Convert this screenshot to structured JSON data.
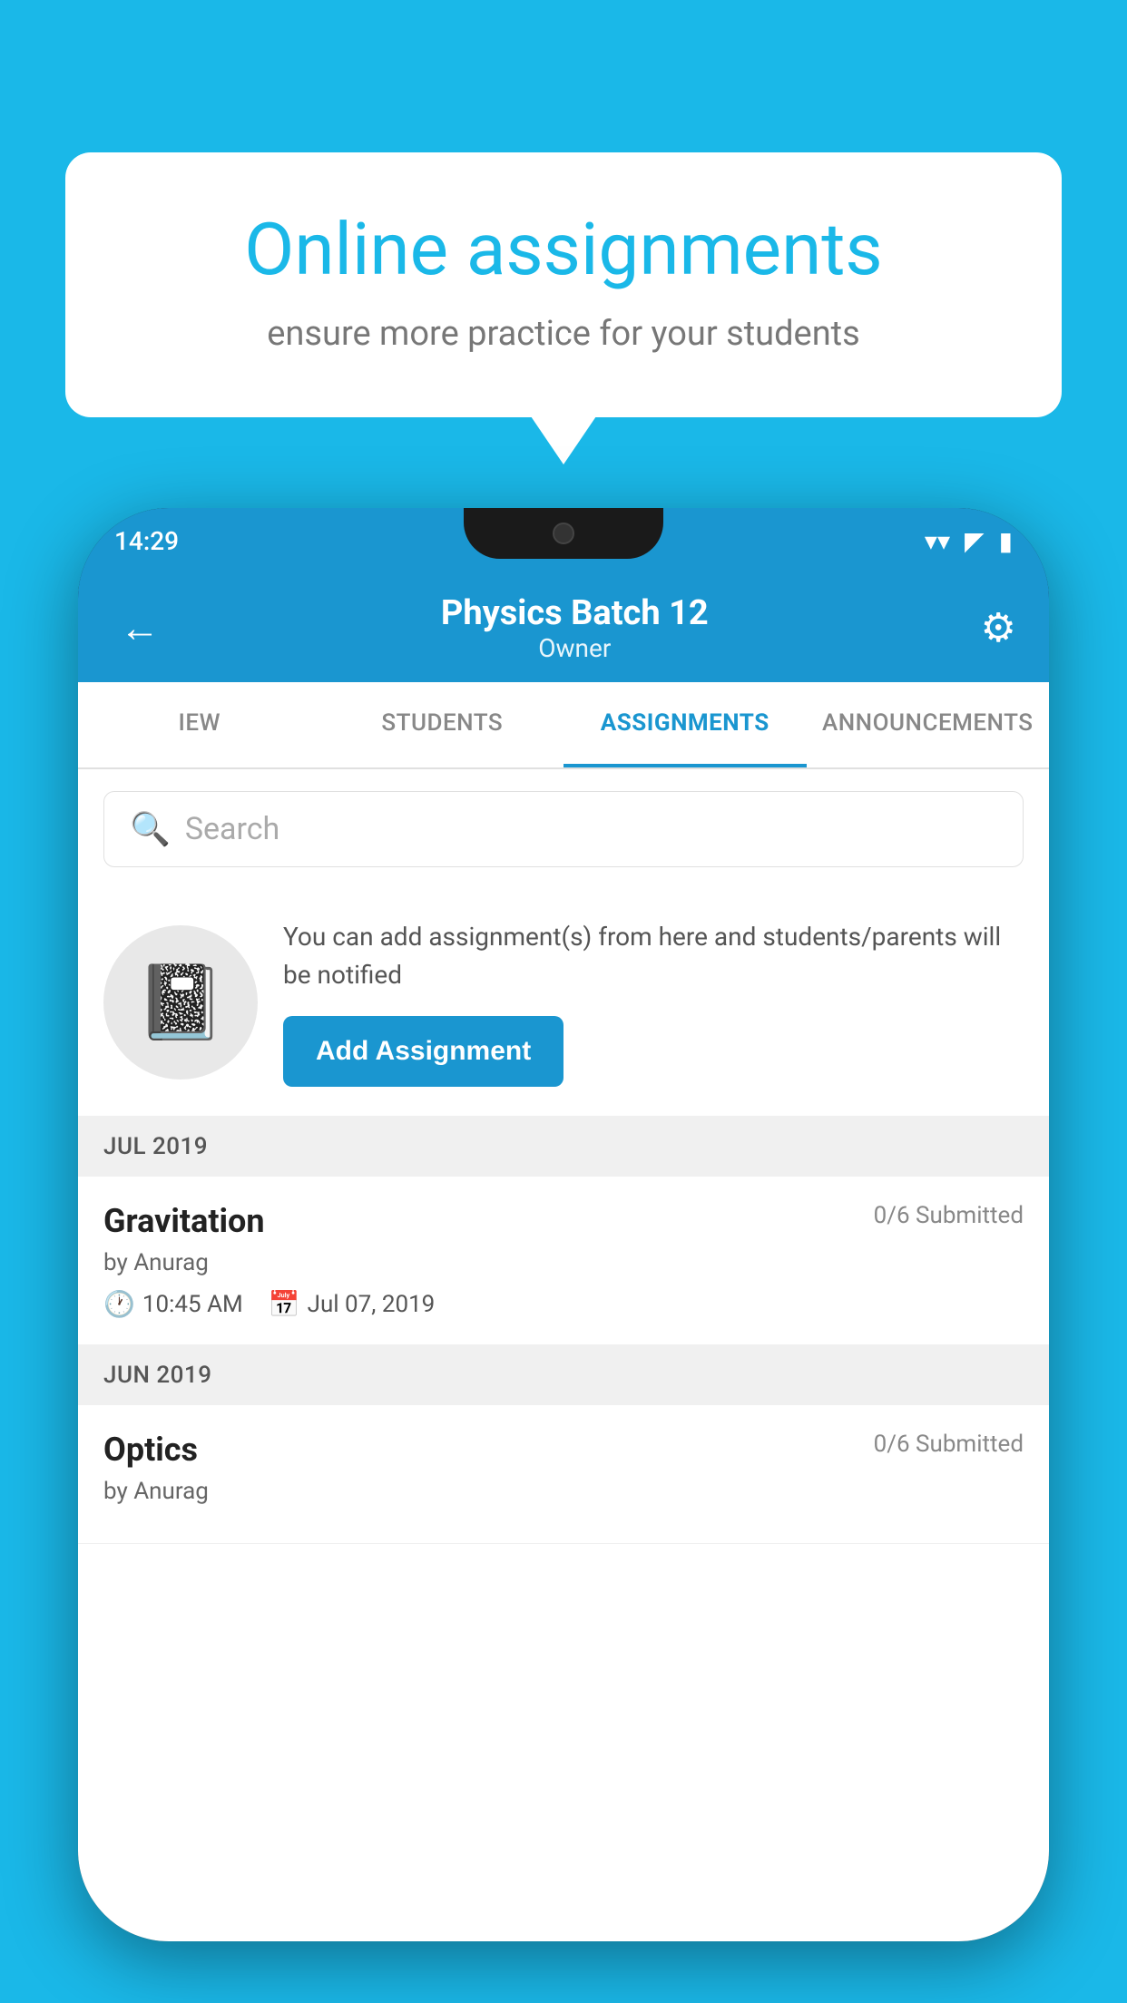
{
  "background_color": "#1ab8e8",
  "speech_bubble": {
    "title": "Online assignments",
    "subtitle": "ensure more practice for your students"
  },
  "status_bar": {
    "time": "14:29",
    "wifi_icon": "▾",
    "signal_icon": "▲",
    "battery_icon": "▮"
  },
  "app_bar": {
    "back_icon": "←",
    "title": "Physics Batch 12",
    "subtitle": "Owner",
    "settings_icon": "⚙"
  },
  "tabs": [
    {
      "label": "IEW",
      "active": false
    },
    {
      "label": "STUDENTS",
      "active": false
    },
    {
      "label": "ASSIGNMENTS",
      "active": true
    },
    {
      "label": "ANNOUNCEMENTS",
      "active": false
    }
  ],
  "search": {
    "placeholder": "Search",
    "search_icon": "🔍"
  },
  "promo": {
    "notebook_icon": "📒",
    "description": "You can add assignment(s) from here and students/parents will be notified",
    "add_button_label": "Add Assignment"
  },
  "sections": [
    {
      "header": "JUL 2019",
      "assignments": [
        {
          "title": "Gravitation",
          "submitted": "0/6 Submitted",
          "author": "by Anurag",
          "time": "10:45 AM",
          "date": "Jul 07, 2019"
        }
      ]
    },
    {
      "header": "JUN 2019",
      "assignments": [
        {
          "title": "Optics",
          "submitted": "0/6 Submitted",
          "author": "by Anurag",
          "time": "",
          "date": ""
        }
      ]
    }
  ]
}
